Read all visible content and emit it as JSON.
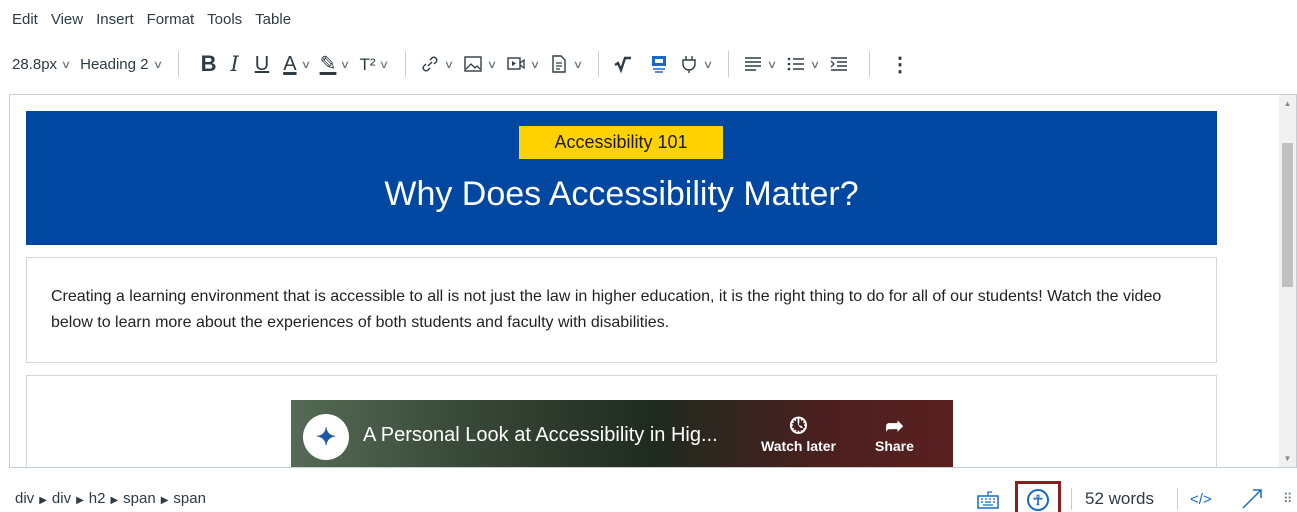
{
  "menubar": {
    "items": [
      "Edit",
      "View",
      "Insert",
      "Format",
      "Tools",
      "Table"
    ]
  },
  "toolbar": {
    "font_size": "28.8px",
    "block_format": "Heading 2",
    "bold_label": "B",
    "italic_label": "I",
    "underline_label": "U",
    "text_color_label": "A",
    "superscript_label": "T²",
    "more_label": "⋮"
  },
  "banner": {
    "badge": "Accessibility 101",
    "title": "Why Does Accessibility Matter?",
    "background_color": "#0047a1",
    "badge_color": "#ffd200"
  },
  "content": {
    "paragraph": "Creating a learning environment that is accessible to all is not just the law in higher education, it is the right thing to do for all of our students! Watch the video below to learn more about the experiences of both students and faculty with disabilities."
  },
  "video": {
    "title": "A Personal Look at Accessibility in Hig...",
    "watch_later": "Watch later",
    "share": "Share"
  },
  "statusbar": {
    "path": [
      "div",
      "div",
      "h2",
      "span",
      "span"
    ],
    "word_count": "52 words",
    "html_toggle": "</>"
  },
  "icons": {
    "link": "link-icon",
    "image": "image-icon",
    "media": "media-icon",
    "document": "document-icon",
    "equation": "equation-icon",
    "embed": "embed-icon",
    "apps": "apps-plug-icon",
    "align": "align-icon",
    "list": "list-icon",
    "indent": "indent-icon",
    "keyboard": "keyboard-icon",
    "accessibility": "accessibility-checker-icon",
    "fullscreen": "fullscreen-icon",
    "resize": "resize-handle-icon"
  }
}
